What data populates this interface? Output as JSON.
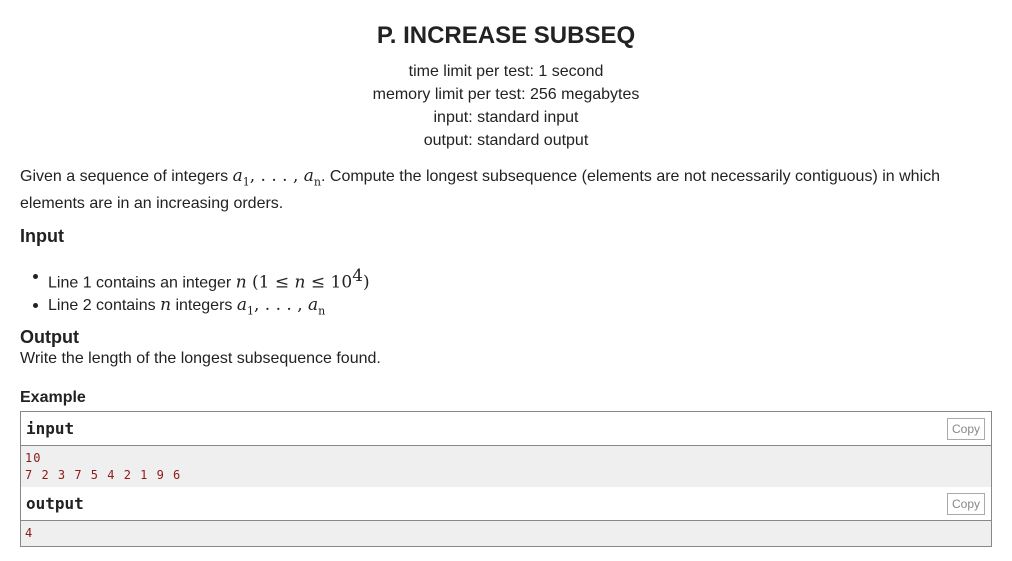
{
  "problem": {
    "title": "P. INCREASE SUBSEQ",
    "limits": [
      "time limit per test: 1 second",
      "memory limit per test: 256 megabytes",
      "input: standard input",
      "output: standard output"
    ],
    "statement": {
      "prefix": "Given a sequence of integers ",
      "seq": "a",
      "sub1": "1",
      "dots": ", . . . , ",
      "subn": "n",
      "suffix": ". Compute the longest subsequence (elements are not necessarily contiguous) in which elements are in an increasing orders."
    },
    "input_section": {
      "title": "Input",
      "line1_text": "Line 1 contains an integer ",
      "line1_var": "n",
      "line1_constraint_open": " (1 ≤ ",
      "line1_constraint_mid": " ≤ 10",
      "line1_exp": "4",
      "line1_close": ")",
      "line2_text1": "Line 2 contains ",
      "line2_var": "n",
      "line2_text2": " integers "
    },
    "output_section": {
      "title": "Output",
      "description": "Write the length of the longest subsequence found."
    },
    "example": {
      "title": "Example",
      "input_label": "input",
      "output_label": "output",
      "copy_label": "Copy",
      "input_lines": [
        "10",
        "7 2 3 7 5 4 2 1 9 6"
      ],
      "output_lines": [
        "4"
      ]
    }
  }
}
